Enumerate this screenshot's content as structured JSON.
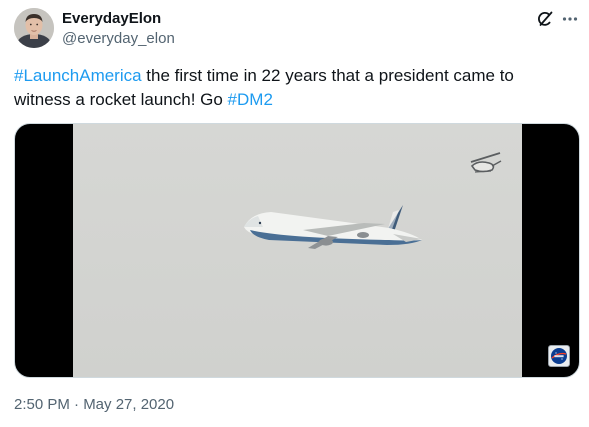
{
  "author": {
    "display_name": "EverydayElon",
    "handle": "@everyday_elon"
  },
  "header_icons": {
    "grok": "grok-icon",
    "more": "more-icon"
  },
  "tweet": {
    "hashtag_1": "#LaunchAmerica",
    "text_1": " the first time in 22 years that a president came to witness a rocket launch! Go ",
    "hashtag_2": "#DM2"
  },
  "media": {
    "type": "video",
    "watermark_icon": "nasa-logo-icon"
  },
  "timestamp": "2:50 PM · May 27, 2020",
  "colors": {
    "link": "#1d9bf0",
    "secondary_text": "#536471",
    "primary_text": "#0f1419"
  }
}
